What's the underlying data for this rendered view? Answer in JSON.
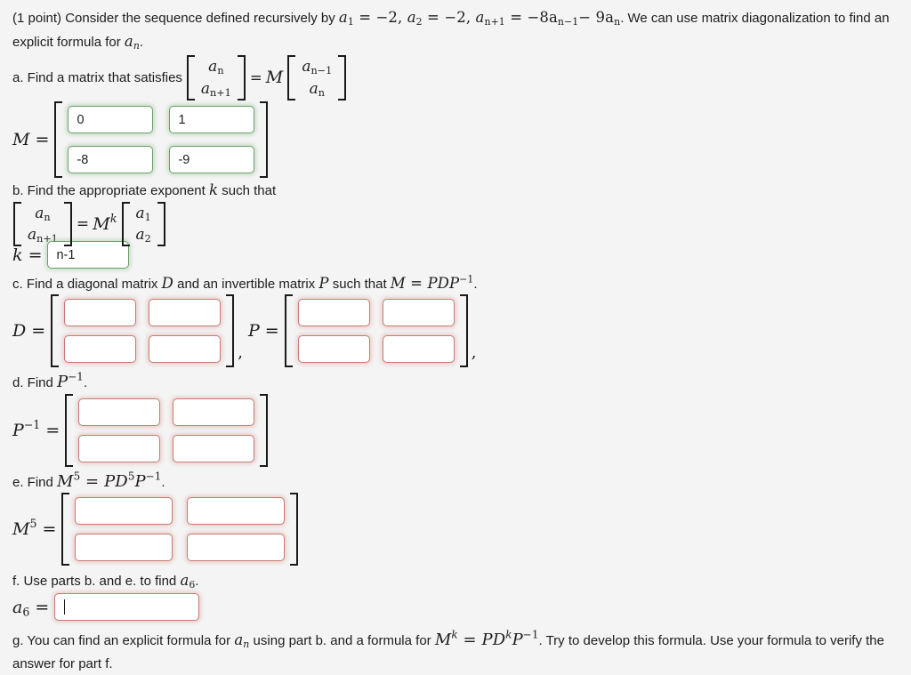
{
  "problem": {
    "points_label": "(1 point)",
    "intro_part1": "Consider the sequence defined recursively by",
    "seq_a1": "a",
    "seq_a1_sub": "1",
    "eq1": "= −2,",
    "seq_a2_sub": "2",
    "eq2": "= −2,",
    "seq_an1_sub": "n+1",
    "eq3": "= −8a",
    "eq3_sub": "n−1",
    "eq4": "− 9a",
    "eq4_sub": "n",
    "intro_part2": ". We can use matrix diagonalization to find an explicit formula for",
    "intro_end": "."
  },
  "parts": {
    "a": {
      "label": "a. Find a matrix that satisfies",
      "lhs_top": "a",
      "lhs_top_sub": "n",
      "lhs_bot": "a",
      "lhs_bot_sub": "n+1",
      "equals": "=",
      "m_symbol": "M",
      "rhs_top": "a",
      "rhs_top_sub": "n−1",
      "rhs_bot": "a",
      "rhs_bot_sub": "n",
      "matrix_label": "M",
      "matrix_equals": "=",
      "values": [
        "0",
        "1",
        "-8",
        "-9"
      ],
      "state": "green"
    },
    "b": {
      "label": "b. Find the appropriate exponent",
      "label_k": "k",
      "label_end": "such that",
      "lhs_top": "a",
      "lhs_top_sub": "n",
      "lhs_bot": "a",
      "lhs_bot_sub": "n+1",
      "equals": "=",
      "m_symbol": "M",
      "m_exp": "k",
      "rhs_top": "a",
      "rhs_top_sub": "1",
      "rhs_bot": "a",
      "rhs_bot_sub": "2",
      "k_label": "k",
      "k_equals": "=",
      "k_value": "n-1",
      "state": "green"
    },
    "c": {
      "label_1": "c. Find a diagonal matrix",
      "sym_D": "D",
      "label_2": "and an invertible matrix",
      "sym_P": "P",
      "label_3": "such that",
      "eq_M": "M",
      "eq_eq": "=",
      "eq_PDP": "PDP",
      "eq_exp": "−1",
      "label_end": ".",
      "d_label": "D",
      "d_equals": "=",
      "d_values": [
        "",
        "",
        "",
        ""
      ],
      "p_label": "P",
      "p_equals": "=",
      "p_values": [
        "",
        "",
        "",
        ""
      ],
      "separator": ",",
      "trailing_comma": ",",
      "state": "red"
    },
    "d": {
      "label": "d. Find",
      "label_P": "P",
      "label_exp": "−1",
      "label_end": ".",
      "matrix_label": "P",
      "matrix_label_exp": "−1",
      "matrix_equals": "=",
      "values": [
        "",
        "",
        "",
        ""
      ],
      "state": "red"
    },
    "e": {
      "label": "e. Find",
      "label_M": "M",
      "label_M_exp": "5",
      "label_eq": "=",
      "label_PD": "PD",
      "label_PD_exp": "5",
      "label_P2": "P",
      "label_P2_exp": "−1",
      "label_end": ".",
      "matrix_label": "M",
      "matrix_label_exp": "5",
      "matrix_equals": "=",
      "values": [
        "",
        "",
        "",
        ""
      ],
      "state": "red"
    },
    "f": {
      "label": "f. Use parts b. and e. to find",
      "label_a": "a",
      "label_a_sub": "6",
      "label_end": ".",
      "field_label": "a",
      "field_label_sub": "6",
      "field_equals": "=",
      "value": "",
      "state": "red",
      "focused": true
    },
    "g": {
      "text_1": "g. You can find an explicit formula for",
      "sym_a": "a",
      "sym_a_sub": "n",
      "text_2": "using part b. and a formula for",
      "eq_M": "M",
      "eq_M_exp": "k",
      "eq_eq": "=",
      "eq_PDP": "PD",
      "eq_PDP_exp": "k",
      "eq_P": "P",
      "eq_P_exp": "−1",
      "text_3": ". Try to develop this formula. Use your formula to verify the answer for part f."
    }
  },
  "colors": {
    "background": "#f4f4f4",
    "input_border_correct": "#69a069",
    "input_border_incorrect": "#ca7a70",
    "text": "#1d1d1d",
    "bracket": "#1a1a1a"
  }
}
